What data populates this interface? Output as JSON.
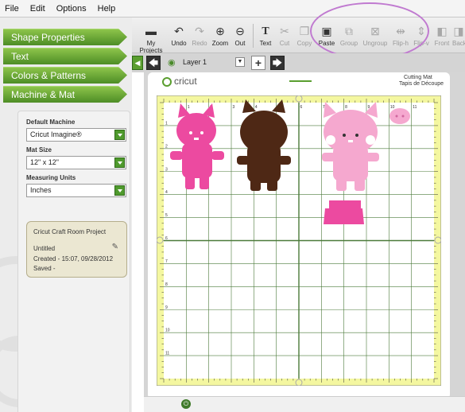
{
  "menu": [
    "File",
    "Edit",
    "Options",
    "Help"
  ],
  "accordion": [
    {
      "label": "Shape Properties"
    },
    {
      "label": "Text"
    },
    {
      "label": "Colors & Patterns"
    },
    {
      "label": "Machine & Mat"
    }
  ],
  "machine_panel": {
    "default_machine_label": "Default Machine",
    "default_machine_value": "Cricut Imagine®",
    "mat_size_label": "Mat Size",
    "mat_size_value": "12\" x 12\"",
    "measuring_units_label": "Measuring Units",
    "measuring_units_value": "Inches",
    "project": {
      "title": "Cricut Craft Room Project",
      "name": "Untitled",
      "created": "Created - 15:07, 09/28/2012",
      "saved": "Saved -"
    }
  },
  "toolbar": [
    {
      "label": "My Projects",
      "icon": "folder-icon",
      "enabled": true
    },
    {
      "label": "Undo",
      "icon": "undo-icon",
      "enabled": true
    },
    {
      "label": "Redo",
      "icon": "redo-icon",
      "enabled": false
    },
    {
      "label": "Zoom",
      "icon": "zoom-in-icon",
      "enabled": true
    },
    {
      "label": "Out",
      "icon": "zoom-out-icon",
      "enabled": true
    },
    {
      "label": "Text",
      "icon": "text-icon",
      "enabled": true
    },
    {
      "label": "Cut",
      "icon": "scissors-icon",
      "enabled": false
    },
    {
      "label": "Copy",
      "icon": "copy-icon",
      "enabled": false
    },
    {
      "label": "Paste",
      "icon": "paste-icon",
      "enabled": true
    },
    {
      "label": "Group",
      "icon": "group-icon",
      "enabled": false
    },
    {
      "label": "Ungroup",
      "icon": "ungroup-icon",
      "enabled": false
    },
    {
      "label": "Flip-h",
      "icon": "flip-h-icon",
      "enabled": false
    },
    {
      "label": "Flip-v",
      "icon": "flip-v-icon",
      "enabled": false
    },
    {
      "label": "Front",
      "icon": "front-icon",
      "enabled": false
    },
    {
      "label": "Back",
      "icon": "back-icon",
      "enabled": false
    }
  ],
  "layer": {
    "label": "Layer 1"
  },
  "mat": {
    "brand": "cricut",
    "title_en": "Cutting Mat",
    "title_fr": "Tapis de Découpe",
    "ruler_numbers": [
      "1",
      "2",
      "3",
      "4",
      "5",
      "6",
      "7",
      "8",
      "9",
      "10",
      "11"
    ]
  },
  "colors": {
    "accent_green": "#5a9e2f",
    "hot_pink": "#ec4aa0",
    "light_pink": "#f5a8cf",
    "brown": "#4e2815",
    "mat_yellow": "#f4f7a0",
    "highlight_circle": "#c07ad0"
  }
}
